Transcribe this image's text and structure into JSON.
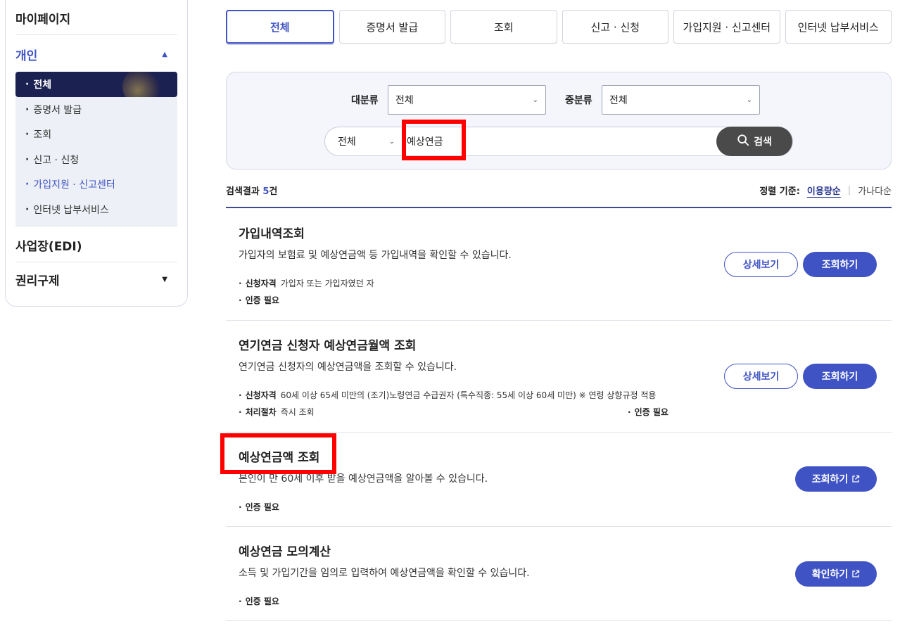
{
  "sidebar": {
    "mypage": "마이페이지",
    "personal": "개인",
    "sub_items": [
      {
        "label": "전체"
      },
      {
        "label": "증명서 발급"
      },
      {
        "label": "조회"
      },
      {
        "label": "신고 · 신청"
      },
      {
        "label": "가입지원 · 신고센터"
      },
      {
        "label": "인터넷 납부서비스"
      }
    ],
    "edi": "사업장(EDI)",
    "rights": "권리구제",
    "bullet": "·"
  },
  "tabs": [
    {
      "label": "전체"
    },
    {
      "label": "증명서 발급"
    },
    {
      "label": "조회"
    },
    {
      "label": "신고 · 신청"
    },
    {
      "label": "가입지원 · 신고센터"
    },
    {
      "label": "인터넷 납부서비스"
    }
  ],
  "search": {
    "major_label": "대분류",
    "major_value": "전체",
    "minor_label": "중분류",
    "minor_value": "전체",
    "scope_value": "전체",
    "query": "예상연금",
    "button_label": "검색"
  },
  "results_header": {
    "count_prefix": "검색결과 ",
    "count": "5",
    "count_suffix": "건",
    "sort_label": "정렬 기준:",
    "sort_active": "이용량순",
    "sort_other": "가나다순"
  },
  "results": [
    {
      "title": "가입내역조회",
      "desc": "가입자의 보험료 및 예상연금액 등 가입내역을 확인할 수 있습니다.",
      "eligibility_label": "신청자격",
      "eligibility": "가입자 또는 가입자였던 자",
      "auth": "인증 필요",
      "detail_btn": "상세보기",
      "action_btn": "조회하기"
    },
    {
      "title": "연기연금 신청자 예상연금월액 조회",
      "desc": "연기연금 신청자의 예상연금액을 조회할 수 있습니다.",
      "eligibility_label": "신청자격",
      "eligibility": "60세 이상 65세 미만의 (조기)노령연금 수급권자 (특수직종: 55세 이상 60세 미만) ※ 연령 상향규정 적용",
      "process_label": "처리절차",
      "process": "즉시 조회",
      "auth": "인증 필요",
      "detail_btn": "상세보기",
      "action_btn": "조회하기"
    },
    {
      "title": "예상연금액 조회",
      "desc": "본인이 만 60세 이후 받을 예상연금액을 알아볼 수 있습니다.",
      "auth": "인증 필요",
      "action_btn": "조회하기"
    },
    {
      "title": "예상연금 모의계산",
      "desc": "소득 및 가입기간을 임의로 입력하여 예상연금액을 확인할 수 있습니다.",
      "auth": "인증 필요",
      "action_btn": "확인하기"
    }
  ],
  "icons": {
    "search": "search-icon",
    "external": "external-link-icon",
    "caret_up": "caret-up-icon",
    "caret_down": "caret-down-icon",
    "chevron": "chevron-down-icon"
  },
  "colors": {
    "accent": "#3f53c4",
    "nav_active": "#1b2150",
    "search_button": "#4a4a4a",
    "highlight": "#ff0000"
  }
}
